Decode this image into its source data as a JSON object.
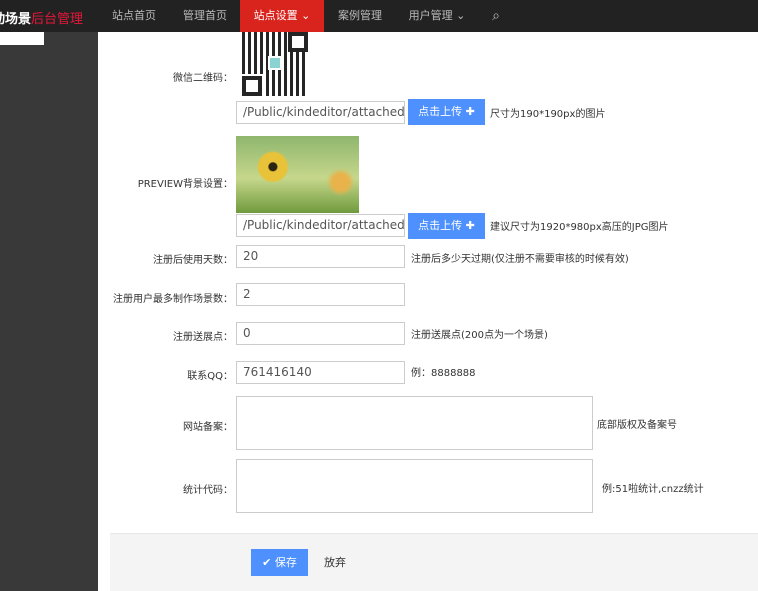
{
  "header": {
    "brand_main": "动场景",
    "brand_accent": "后台管理",
    "nav": [
      {
        "label": "站点首页"
      },
      {
        "label": "管理首页"
      },
      {
        "label": "站点设置",
        "active": true
      },
      {
        "label": "案例管理"
      },
      {
        "label": "用户管理"
      }
    ]
  },
  "form": {
    "qrcode": {
      "label": "微信二维码：",
      "value": "/Public/kindeditor/attached/in",
      "button": "点击上传",
      "hint": "尺寸为190*190px的图片"
    },
    "preview_bg": {
      "label": "PREVIEW背景设置：",
      "value": "/Public/kindeditor/attached/in",
      "button": "点击上传",
      "hint": "建议尺寸为1920*980px高压的JPG图片"
    },
    "days": {
      "label": "注册后使用天数：",
      "value": "20",
      "hint": "注册后多少天过期(仅注册不需要审核的时候有效)"
    },
    "max_scenes": {
      "label": "注册用户最多制作场景数：",
      "value": "2"
    },
    "points": {
      "label": "注册送展点：",
      "value": "0",
      "hint": "注册送展点(200点为一个场景)"
    },
    "qq": {
      "label": "联系QQ：",
      "value": "761416140",
      "hint": "例：8888888"
    },
    "icp": {
      "label": "网站备案：",
      "value": "",
      "hint": "底部版权及备案号"
    },
    "stats": {
      "label": "统计代码：",
      "value": "",
      "hint": "例:51啦统计,cnzz统计"
    }
  },
  "actions": {
    "save": "保存",
    "cancel": "放弃"
  },
  "colors": {
    "accent": "#4d90fe",
    "nav_active": "#d9241e"
  }
}
